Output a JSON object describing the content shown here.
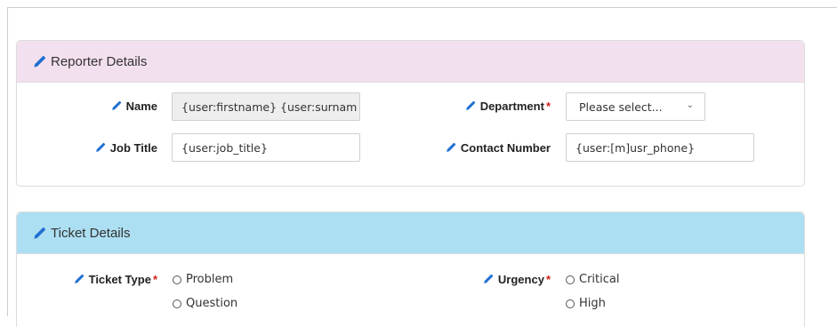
{
  "reporter": {
    "title": "Reporter Details",
    "name_label": "Name",
    "name_value": "{user:firstname} {user:surnam",
    "job_title_label": "Job Title",
    "job_title_value": "{user:job_title}",
    "department_label": "Department",
    "department_value": "Please select...",
    "contact_label": "Contact Number",
    "contact_value": "{user:[m]usr_phone}"
  },
  "ticket": {
    "title": "Ticket Details",
    "type_label": "Ticket Type",
    "type_options": [
      "Problem",
      "Question"
    ],
    "urgency_label": "Urgency",
    "urgency_options": [
      "Critical",
      "High"
    ]
  },
  "required_marker": "*",
  "colors": {
    "reporter_header": "#f3e0ee",
    "ticket_header": "#addff3",
    "pencil_icon": "#1f6fd1",
    "required": "#d0201b"
  }
}
